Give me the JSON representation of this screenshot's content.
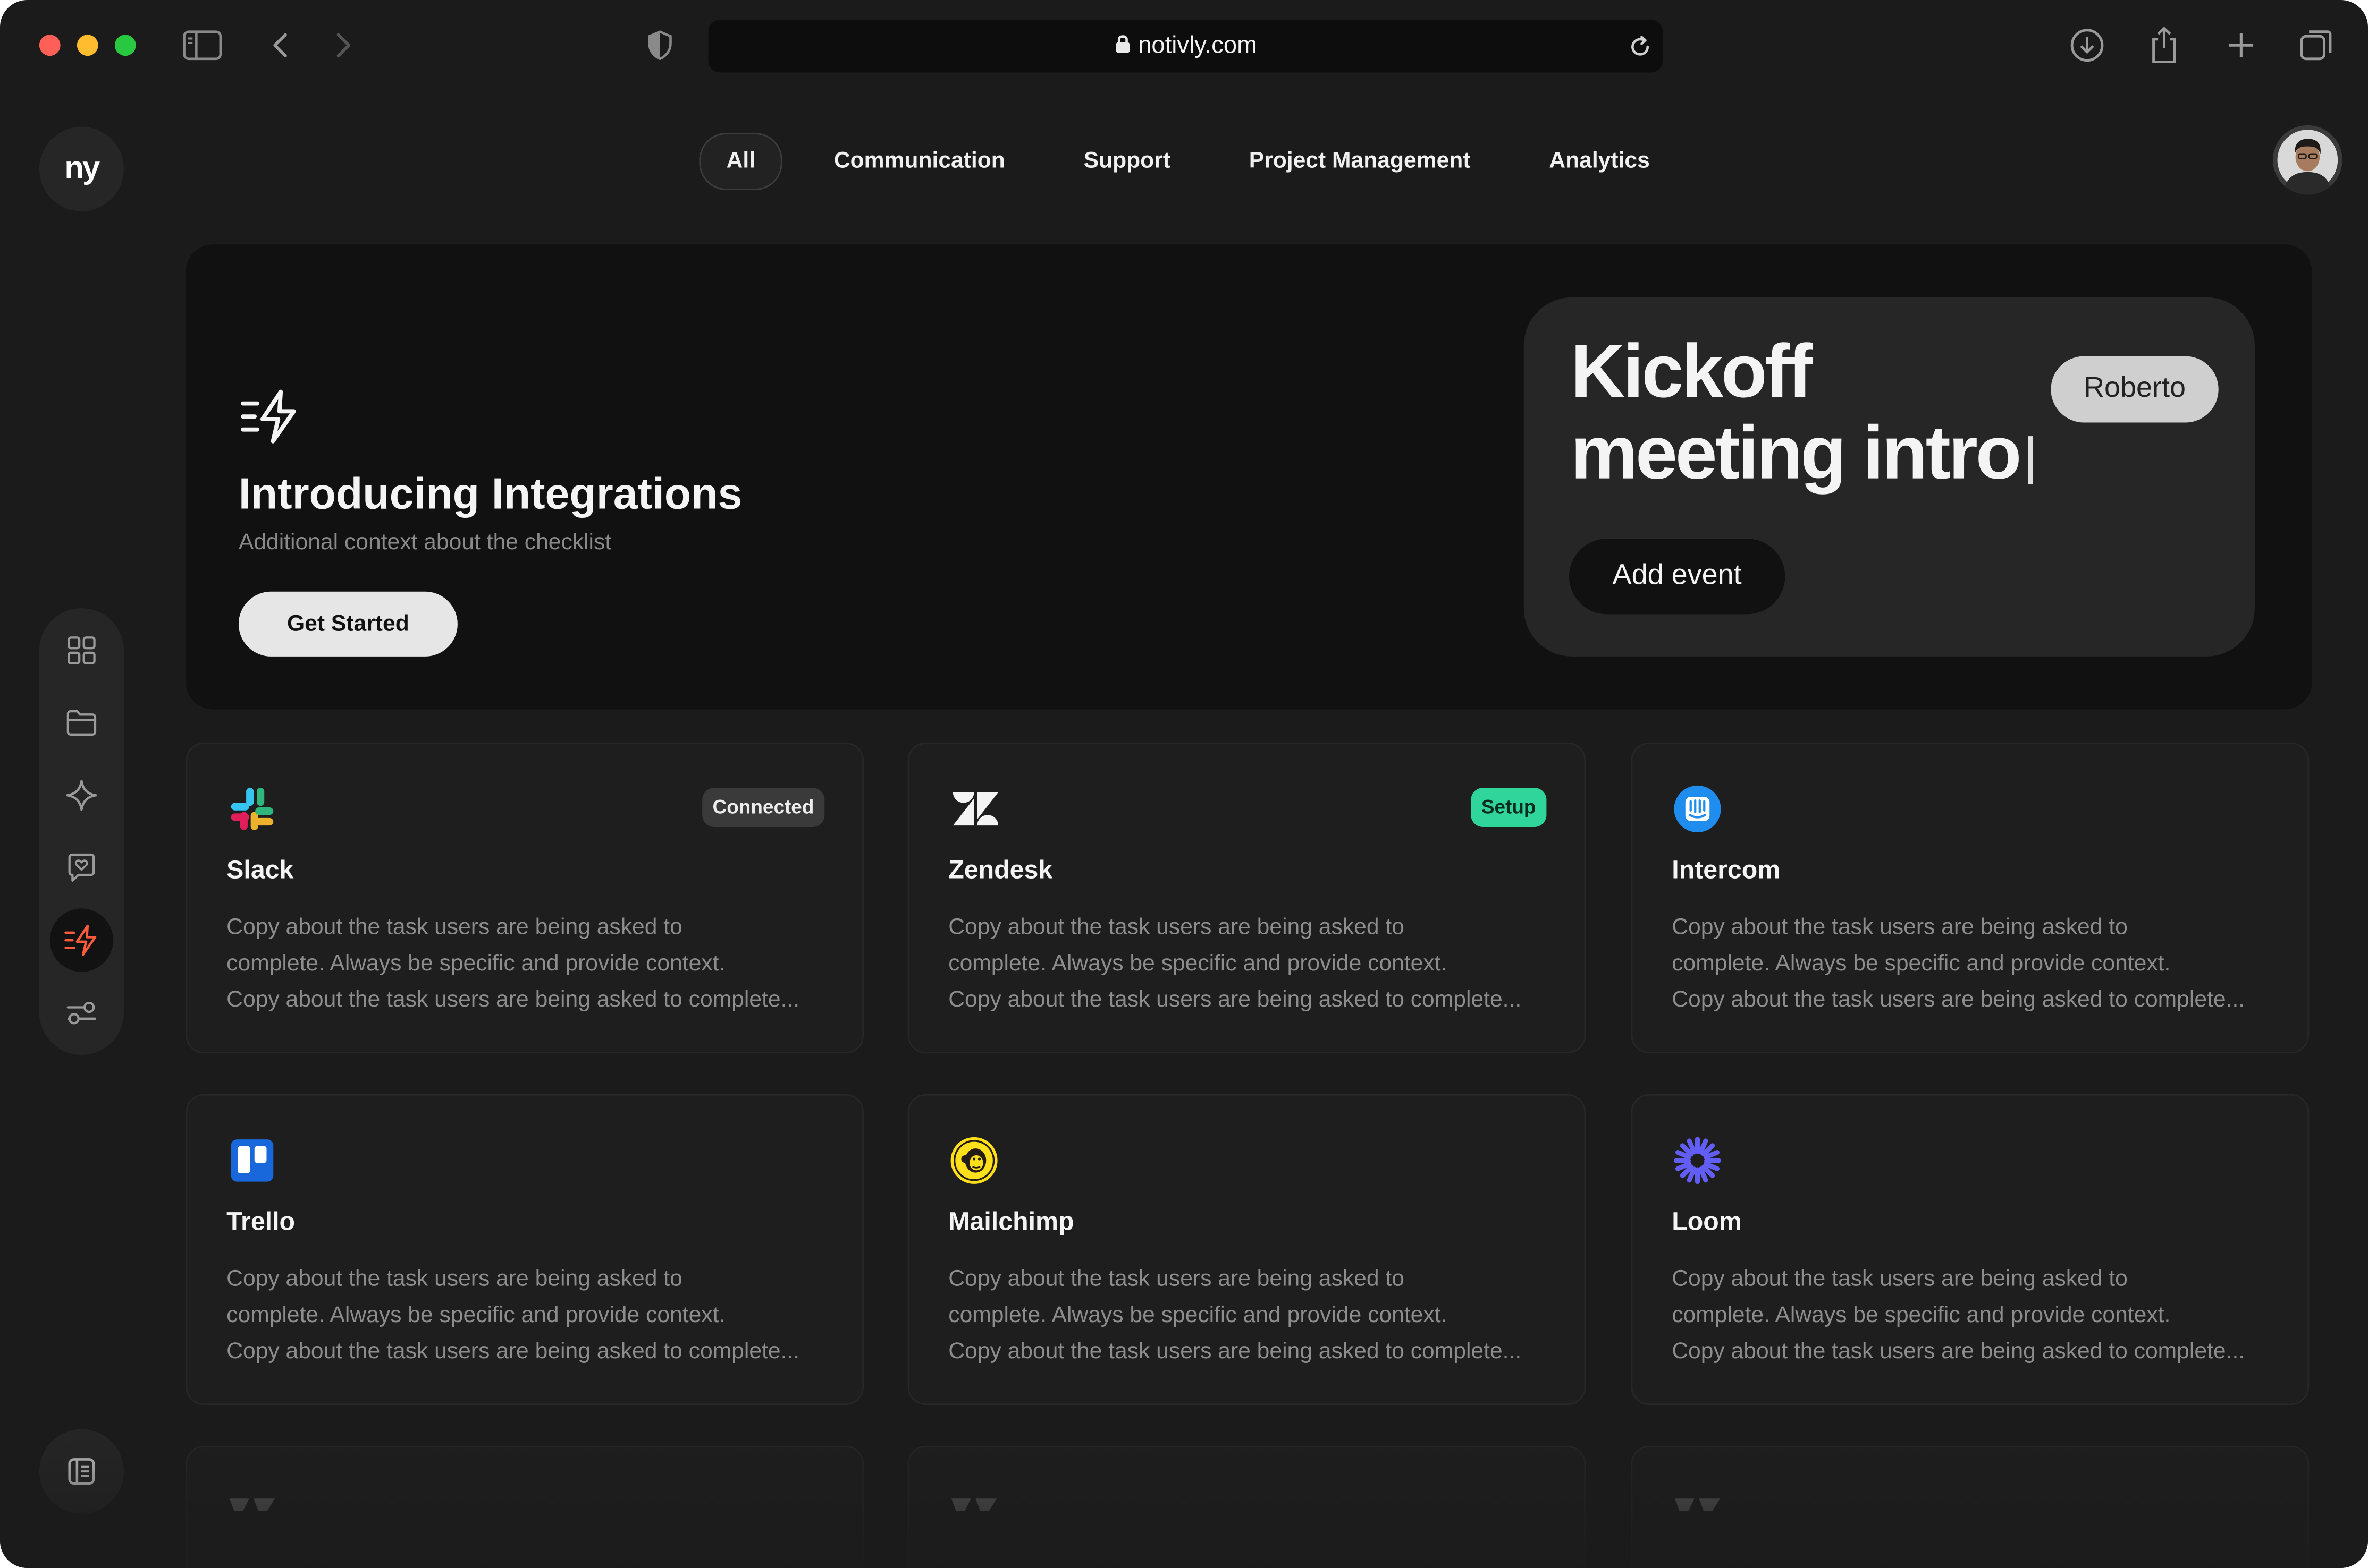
{
  "browser": {
    "url": "notivly.com",
    "traffic_lights": [
      "#fe5f57",
      "#febc2e",
      "#28c840"
    ]
  },
  "brand": {
    "logo_text": "ny"
  },
  "tabs": [
    {
      "label": "All",
      "active": true
    },
    {
      "label": "Communication"
    },
    {
      "label": "Support"
    },
    {
      "label": "Project Management"
    },
    {
      "label": "Analytics"
    }
  ],
  "sidebar": {
    "items": [
      {
        "icon": "grid-icon"
      },
      {
        "icon": "folder-icon"
      },
      {
        "icon": "sparkle-icon"
      },
      {
        "icon": "chat-heart-icon"
      },
      {
        "icon": "integrations-bolt-icon",
        "active": true
      },
      {
        "icon": "sliders-icon"
      }
    ],
    "accent": "#ff5a3c"
  },
  "hero": {
    "title": "Introducing Integrations",
    "subtitle": "Additional context about the checklist",
    "cta": "Get Started",
    "preview": {
      "title_line1": "Kickoff",
      "title_line2": "meeting intro",
      "pill": "Roberto",
      "button": "Add event"
    }
  },
  "integrations": [
    {
      "name": "Slack",
      "badge": "Connected",
      "logo": "slack-logo",
      "desc": [
        "Copy about the task users are being asked to",
        "complete. Always be specific and provide context.",
        "Copy about the task users are being asked to complete..."
      ]
    },
    {
      "name": "Zendesk",
      "badge": "Setup",
      "logo": "zendesk-logo",
      "desc": [
        "Copy about the task users are being asked to",
        "complete. Always be specific and provide context.",
        "Copy about the task users are being asked to complete..."
      ]
    },
    {
      "name": "Intercom",
      "badge": "",
      "logo": "intercom-logo",
      "desc": [
        "Copy about the task users are being asked to",
        "complete. Always be specific and provide context.",
        "Copy about the task users are being asked to complete..."
      ]
    },
    {
      "name": "Trello",
      "badge": "",
      "logo": "trello-logo",
      "desc": [
        "Copy about the task users are being asked to",
        "complete. Always be specific and provide context.",
        "Copy about the task users are being asked to complete..."
      ]
    },
    {
      "name": "Mailchimp",
      "badge": "",
      "logo": "mailchimp-logo",
      "desc": [
        "Copy about the task users are being asked to",
        "complete. Always be specific and provide context.",
        "Copy about the task users are being asked to complete..."
      ]
    },
    {
      "name": "Loom",
      "badge": "",
      "logo": "loom-logo",
      "desc": [
        "Copy about the task users are being asked to",
        "complete. Always be specific and provide context.",
        "Copy about the task users are being asked to complete..."
      ]
    }
  ],
  "colors": {
    "setup_badge": "#2fd59b",
    "trello": "#1868db",
    "intercom": "#1f8ded",
    "loom": "#625df5",
    "mailchimp": "#ffe01b"
  }
}
